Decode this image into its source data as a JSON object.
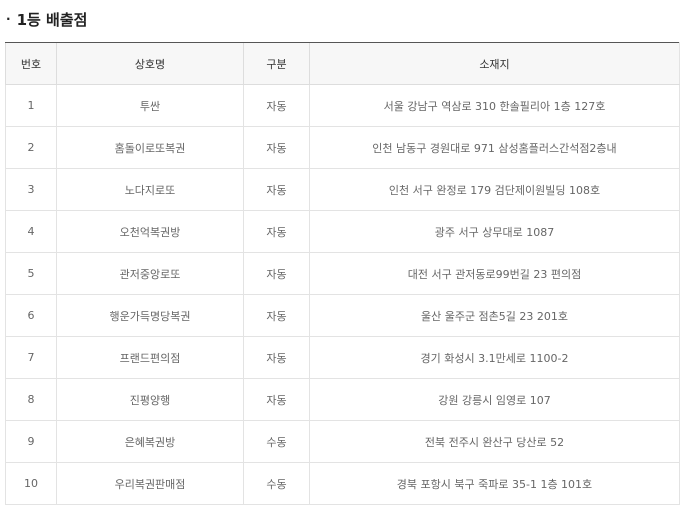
{
  "section": {
    "bullet": "·",
    "title": "1등 배출점"
  },
  "table": {
    "headers": {
      "no": "번호",
      "name": "상호명",
      "type": "구분",
      "address": "소재지"
    },
    "rows": [
      {
        "no": "1",
        "name": "투싼",
        "type": "자동",
        "address": "서울 강남구 역삼로 310 한솔필리아 1층 127호"
      },
      {
        "no": "2",
        "name": "홈돌이로또복권",
        "type": "자동",
        "address": "인천 남동구 경원대로 971 삼성홈플러스간석점2층내"
      },
      {
        "no": "3",
        "name": "노다지로또",
        "type": "자동",
        "address": "인천 서구 완정로 179 검단제이원빌딩 108호"
      },
      {
        "no": "4",
        "name": "오천억복권방",
        "type": "자동",
        "address": "광주 서구 상무대로 1087"
      },
      {
        "no": "5",
        "name": "관저중앙로또",
        "type": "자동",
        "address": "대전 서구 관저동로99번길 23 편의점"
      },
      {
        "no": "6",
        "name": "행운가득명당복권",
        "type": "자동",
        "address": "울산 울주군 점촌5길 23 201호"
      },
      {
        "no": "7",
        "name": "프랜드편의점",
        "type": "자동",
        "address": "경기 화성시 3.1만세로 1100-2"
      },
      {
        "no": "8",
        "name": "진평양행",
        "type": "자동",
        "address": "강원 강릉시 임영로 107"
      },
      {
        "no": "9",
        "name": "은혜복권방",
        "type": "수동",
        "address": "전북 전주시 완산구 당산로 52"
      },
      {
        "no": "10",
        "name": "우리복권판매점",
        "type": "수동",
        "address": "경북 포항시 북구 죽파로 35-1 1층 101호"
      }
    ]
  }
}
